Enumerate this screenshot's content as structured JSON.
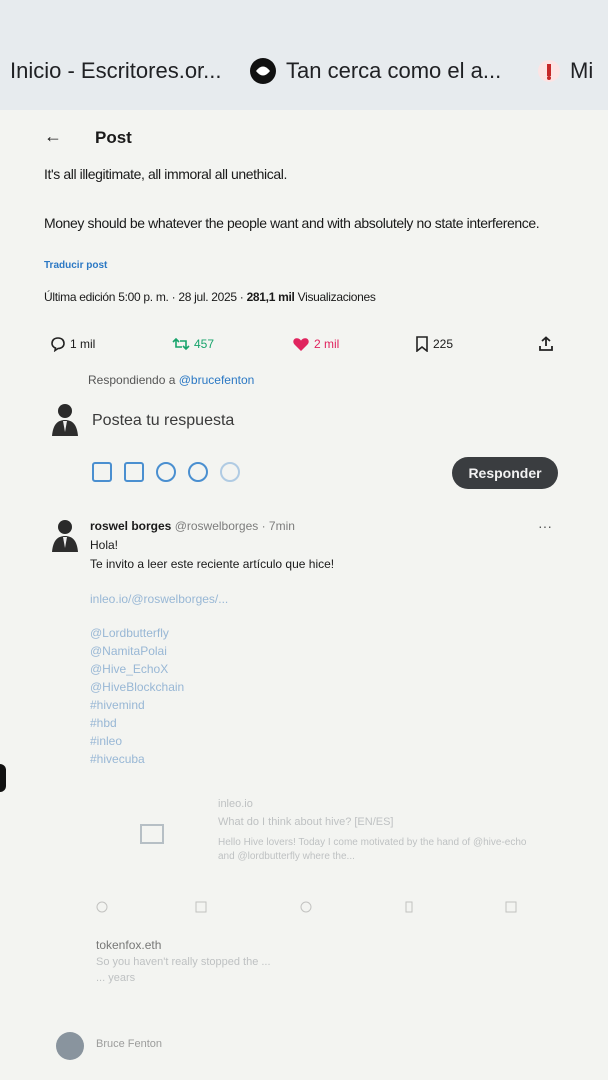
{
  "browser": {
    "tabs": [
      {
        "title": "Inicio - Escritores.or..."
      },
      {
        "title": "Tan cerca como el a..."
      },
      {
        "title": "Mi"
      }
    ]
  },
  "header": {
    "back_label": "←",
    "title": "Post"
  },
  "post": {
    "line1": "It's all illegitimate, all immoral all unethical.",
    "line2": "Money should be whatever the people want and with absolutely no state interference.",
    "translate": "Traducir post",
    "meta_edit": "Última edición 5:00 p. m. · 28 jul. 2025 ·",
    "meta_views": "281,1 mil",
    "meta_views_label": "Visualizaciones"
  },
  "actions": {
    "replies": "1 mil",
    "reposts": "457",
    "likes": "2 mil",
    "bookmarks": "225"
  },
  "composer": {
    "replying_to_prefix": "Respondiendo a",
    "replying_to_handle": "@brucefenton",
    "placeholder": "Postea tu respuesta",
    "reply_button": "Responder"
  },
  "reply": {
    "name": "roswel borges",
    "handle_time": "@roswelborges · 7min",
    "greeting": "Hola!",
    "text": "Te invito a leer este reciente artículo que hice!",
    "link": "inleo.io/@roswelborges/...",
    "tags": [
      "@Lordbutterfly",
      "@NamitaPolai",
      "@Hive_EchoX",
      "@HiveBlockchain",
      "#hivemind",
      "#hbd",
      "#inleo",
      "#hivecuba"
    ],
    "card_source": "inleo.io",
    "card_title": "What do I think about hive? [EN/ES]",
    "card_desc": "Hello Hive lovers! Today I come motivated by the hand of @hive-echo and @lordbutterfly where the..."
  },
  "reply2": {
    "name": "tokenfox.eth",
    "text": "So you haven't really stopped the ...",
    "more": "... years"
  },
  "reply3": {
    "name": "Bruce Fenton"
  },
  "colors": {
    "like": "#e0245e",
    "repost": "#17a36b",
    "link": "#2b78c4",
    "button": "#3a3d40"
  }
}
